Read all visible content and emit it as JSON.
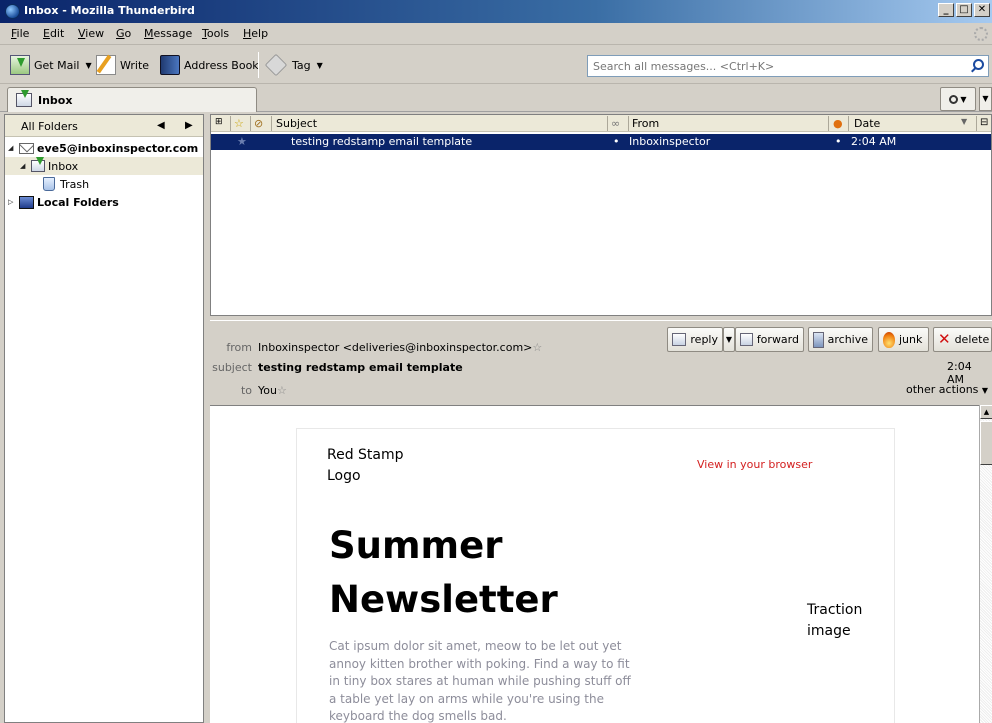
{
  "window": {
    "title": "Inbox - Mozilla Thunderbird",
    "min": "_",
    "max": "□",
    "close": "✕"
  },
  "menu": [
    "File",
    "Edit",
    "View",
    "Go",
    "Message",
    "Tools",
    "Help"
  ],
  "toolbar": {
    "get_mail": "Get Mail",
    "write": "Write",
    "address_book": "Address Book",
    "tag": "Tag",
    "search_placeholder": "Search all messages... <Ctrl+K>"
  },
  "tabs": [
    {
      "label": "Inbox"
    }
  ],
  "folders": {
    "header": "All Folders",
    "items": [
      {
        "label": "eve5@inboxinspector.com",
        "bold": true
      },
      {
        "label": "Inbox",
        "selected": true
      },
      {
        "label": "Trash"
      },
      {
        "label": "Local Folders",
        "bold": true
      }
    ]
  },
  "threads": {
    "columns": {
      "subject": "Subject",
      "from": "From",
      "date": "Date"
    },
    "rows": [
      {
        "subject": "testing redstamp email template",
        "from": "Inboxinspector",
        "date": "2:04 AM"
      }
    ]
  },
  "message": {
    "from_label": "from",
    "from": "Inboxinspector <deliveries@inboxinspector.com>",
    "subject_label": "subject",
    "subject": "testing redstamp email template",
    "to_label": "to",
    "to": "You",
    "time": "2:04 AM",
    "other_actions": "other actions",
    "buttons": {
      "reply": "reply",
      "forward": "forward",
      "archive": "archive",
      "junk": "junk",
      "delete": "delete"
    }
  },
  "email": {
    "logo": "Red Stamp Logo",
    "view_browser": "View in your browser",
    "title": "Summer Newsletter",
    "traction": "Traction image",
    "body": "Cat ipsum dolor sit amet, meow to be let out yet annoy kitten brother with poking. Find a way to fit in tiny box stares at human while pushing stuff off a table yet lay on arms while you're using the keyboard the dog smells bad."
  }
}
